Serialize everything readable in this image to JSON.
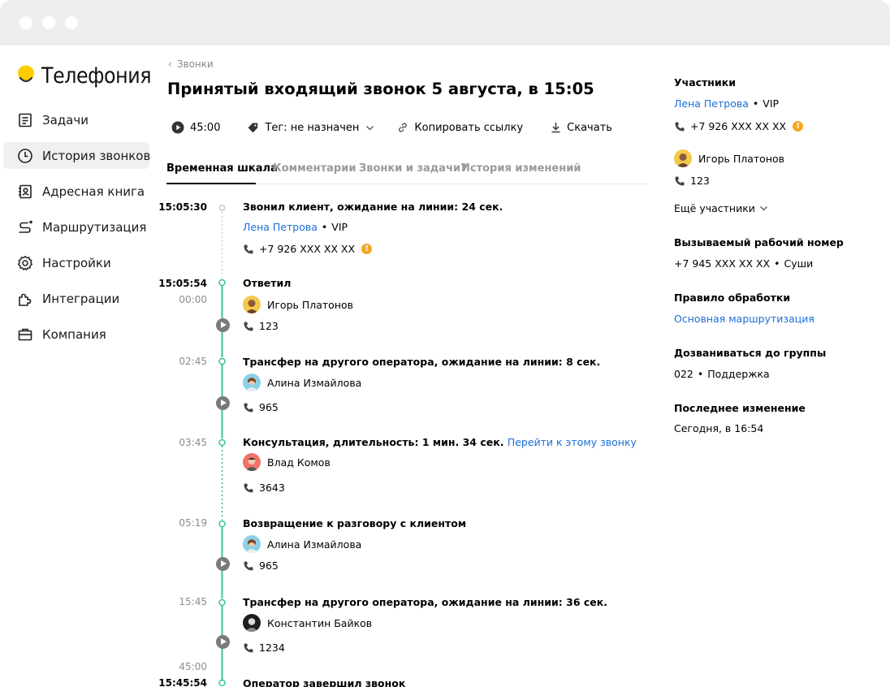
{
  "app": {
    "title": "Телефония"
  },
  "sidebar": {
    "items": [
      {
        "label": "Задачи",
        "icon": "tasks-icon"
      },
      {
        "label": "История звонков",
        "icon": "clock-icon",
        "active": true
      },
      {
        "label": "Адресная книга",
        "icon": "address-book-icon"
      },
      {
        "label": "Маршрутизация",
        "icon": "routing-icon"
      },
      {
        "label": "Настройки",
        "icon": "gear-icon"
      },
      {
        "label": "Интеграции",
        "icon": "puzzle-icon"
      },
      {
        "label": "Компания",
        "icon": "briefcase-icon"
      }
    ]
  },
  "header": {
    "breadcrumb": "Звонки",
    "title": "Принятый входящий звонок 5 августа, в 15:05"
  },
  "toolbar": {
    "duration": "45:00",
    "tag": "Тег: не назначен",
    "copy_link": "Копировать ссылку",
    "download": "Скачать"
  },
  "tabs": [
    "Временная шкала",
    "Комментарии",
    "Звонки и задачи?",
    "История изменений"
  ],
  "timeline": {
    "e1": {
      "time": "15:05:30",
      "title": "Звонил клиент, ожидание на линии: 24 сек.",
      "name": "Лена Петрова",
      "tag": "VIP",
      "phone": "+7 926 XXX XX XX"
    },
    "e2": {
      "time": "15:05:54",
      "offset": "00:00",
      "title": "Ответил",
      "name": "Игорь Платонов",
      "phone": "123"
    },
    "e3": {
      "offset": "02:45",
      "title": "Трансфер на другого оператора, ожидание на линии: 8 сек.",
      "name": "Алина Измайлова",
      "phone": "965"
    },
    "e4": {
      "offset": "03:45",
      "title": "Консультация, длительность: 1 мин. 34 сек.",
      "link": "Перейти к этому звонку",
      "name": "Влад Комов",
      "phone": "3643"
    },
    "e5": {
      "offset": "05:19",
      "title": "Возвращение к разговору с клиентом",
      "name": "Алина Измайлова",
      "phone": "965"
    },
    "e6": {
      "offset": "15:45",
      "title": "Трансфер на другого оператора, ожидание на линии: 36 сек.",
      "name": "Константин Байков",
      "phone": "1234"
    },
    "e7": {
      "offset": "45:00",
      "time": "15:45:54",
      "title": "Оператор завершил звонок"
    }
  },
  "right_panel": {
    "participants_label": "Участники",
    "p1_name": "Лена Петрова",
    "p1_tag": "VIP",
    "p1_phone": "+7 926 XXX XX XX",
    "p2_name": "Игорь Платонов",
    "p2_phone": "123",
    "more": "Ещё участники",
    "work_number_label": "Вызываемый рабочий номер",
    "work_number": "+7 945 XXX XX XX",
    "work_number_name": "Суши",
    "rule_label": "Правило обработки",
    "rule_value": "Основная маршрутизация",
    "group_label": "Дозваниваться до группы",
    "group_number": "022",
    "group_name": "Поддержка",
    "last_change_label": "Последнее изменение",
    "last_change_value": "Сегодня, в 16:54"
  },
  "colors": {
    "accent": "#1a6ed8",
    "timeline_green": "#3cc58a",
    "warning": "#f5a623",
    "logo_yellow": "#ffcc00"
  }
}
